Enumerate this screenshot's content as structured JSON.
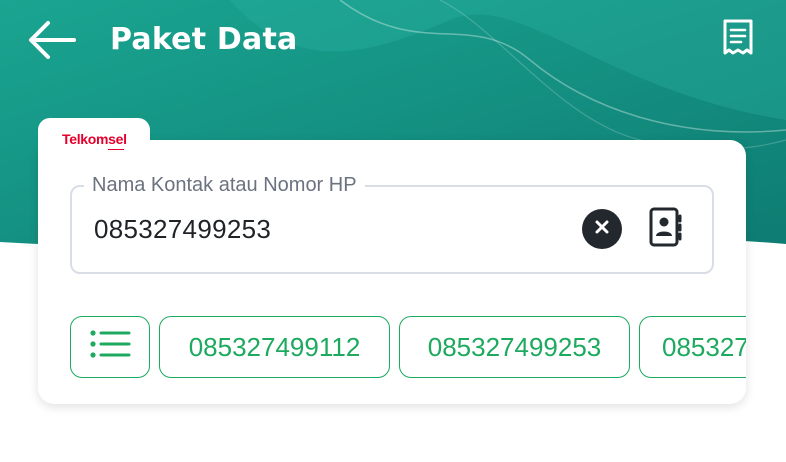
{
  "header": {
    "title": "Paket Data",
    "back_icon": "arrow-left-icon",
    "history_icon": "receipt-icon",
    "gradient": [
      "#1aa08f",
      "#0f7f73"
    ]
  },
  "provider": {
    "name": "Telkomsel",
    "color": "#e4002b"
  },
  "phone_input": {
    "label": "Nama Kontak atau Nomor HP",
    "value": "085327499253",
    "clear_icon": "clear-icon",
    "contact_icon": "contact-book-icon"
  },
  "recent_numbers": {
    "list_icon": "list-icon",
    "items": [
      "085327499112",
      "085327499253",
      "085327"
    ]
  },
  "colors": {
    "accent_green": "#1daa5f",
    "card_bg": "#ffffff",
    "input_border": "#d8dde6"
  }
}
